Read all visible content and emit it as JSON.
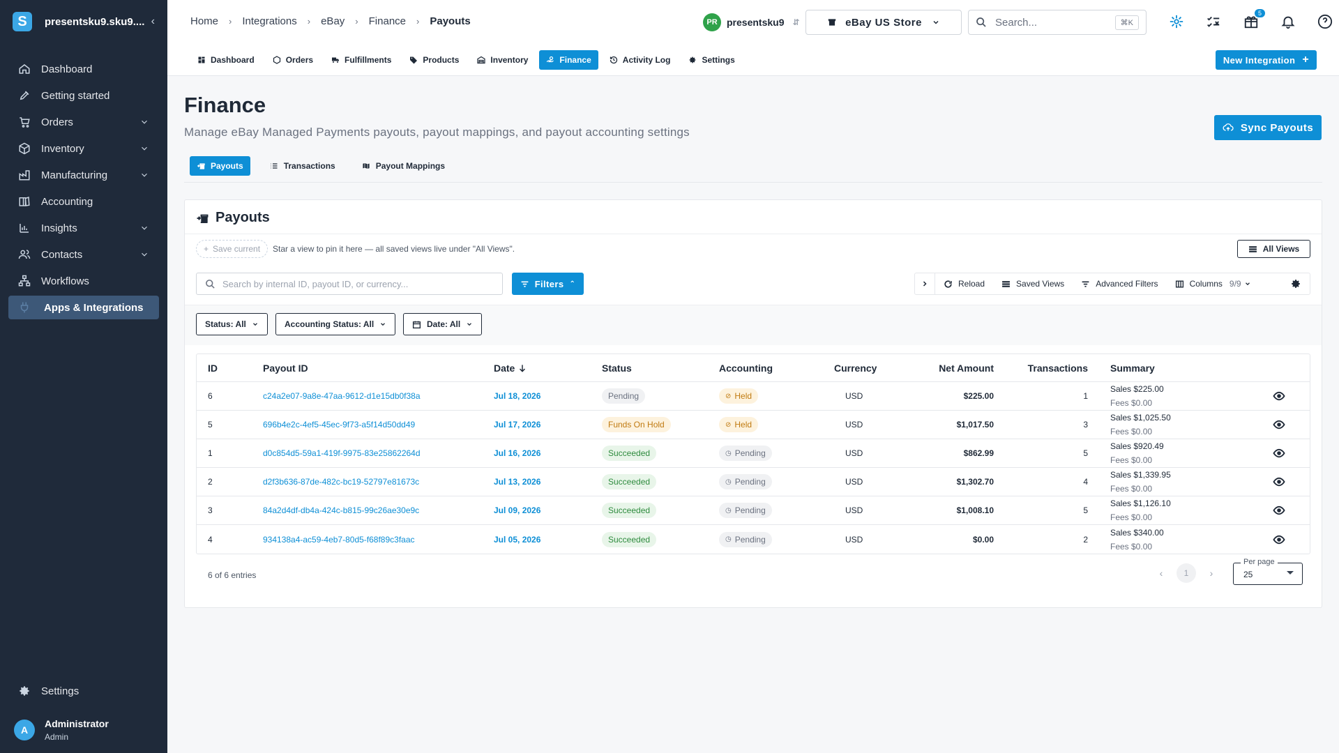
{
  "sidebar": {
    "brand_logo": "S",
    "brand_name": "presentsku9.sku9....",
    "items": [
      {
        "label": "Dashboard"
      },
      {
        "label": "Getting started"
      },
      {
        "label": "Orders"
      },
      {
        "label": "Inventory"
      },
      {
        "label": "Manufacturing"
      },
      {
        "label": "Accounting"
      },
      {
        "label": "Insights"
      },
      {
        "label": "Contacts"
      },
      {
        "label": "Workflows"
      },
      {
        "label": "Apps & Integrations"
      }
    ],
    "settings_label": "Settings",
    "user": {
      "initial": "A",
      "name": "Administrator",
      "role": "Admin"
    }
  },
  "breadcrumbs": [
    "Home",
    "Integrations",
    "eBay",
    "Finance",
    "Payouts"
  ],
  "account": {
    "initials": "PR",
    "name": "presentsku9"
  },
  "store_label": "eBay US Store",
  "global_search": {
    "placeholder": "Search...",
    "shortcut": "⌘K"
  },
  "notifications_count": "5",
  "subnav": {
    "items": [
      {
        "label": "Dashboard"
      },
      {
        "label": "Orders"
      },
      {
        "label": "Fulfillments"
      },
      {
        "label": "Products"
      },
      {
        "label": "Inventory"
      },
      {
        "label": "Finance"
      },
      {
        "label": "Activity Log"
      },
      {
        "label": "Settings"
      }
    ],
    "new_integration": "New Integration"
  },
  "page": {
    "title": "Finance",
    "subtitle": "Manage eBay Managed Payments payouts, payout mappings, and payout accounting settings",
    "sync_label": "Sync Payouts"
  },
  "tabs": [
    {
      "label": "Payouts"
    },
    {
      "label": "Transactions"
    },
    {
      "label": "Payout Mappings"
    }
  ],
  "card": {
    "title": "Payouts",
    "save_current": "Save current",
    "save_hint": "Star a view to pin it here — all saved views live under \"All Views\".",
    "all_views": "All Views",
    "search_placeholder": "Search by internal ID, payout ID, or currency...",
    "filters_label": "Filters",
    "toolbar": {
      "reload": "Reload",
      "saved_views": "Saved Views",
      "advanced_filters": "Advanced Filters",
      "columns": "Columns",
      "columns_count": "9/9"
    },
    "chips": {
      "status": "Status: All",
      "accounting": "Accounting Status: All",
      "date": "Date: All"
    }
  },
  "table": {
    "headers": {
      "id": "ID",
      "payout_id": "Payout ID",
      "date": "Date",
      "status": "Status",
      "accounting": "Accounting",
      "currency": "Currency",
      "net": "Net Amount",
      "transactions": "Transactions",
      "summary": "Summary"
    },
    "rows": [
      {
        "id": "6",
        "payout_id": "c24a2e07-9a8e-47aa-9612-d1e15db0f38a",
        "date": "Jul 18, 2026",
        "status": "Pending",
        "status_kind": "pending",
        "accounting": "Held",
        "accounting_kind": "held",
        "currency": "USD",
        "net": "$225.00",
        "transactions": "1",
        "sales": "Sales $225.00",
        "fees": "Fees $0.00"
      },
      {
        "id": "5",
        "payout_id": "696b4e2c-4ef5-45ec-9f73-a5f14d50dd49",
        "date": "Jul 17, 2026",
        "status": "Funds On Hold",
        "status_kind": "hold",
        "accounting": "Held",
        "accounting_kind": "held",
        "currency": "USD",
        "net": "$1,017.50",
        "transactions": "3",
        "sales": "Sales $1,025.50",
        "fees": "Fees $0.00"
      },
      {
        "id": "1",
        "payout_id": "d0c854d5-59a1-419f-9975-83e25862264d",
        "date": "Jul 16, 2026",
        "status": "Succeeded",
        "status_kind": "succ",
        "accounting": "Pending",
        "accounting_kind": "pending",
        "currency": "USD",
        "net": "$862.99",
        "transactions": "5",
        "sales": "Sales $920.49",
        "fees": "Fees $0.00"
      },
      {
        "id": "2",
        "payout_id": "d2f3b636-87de-482c-bc19-52797e81673c",
        "date": "Jul 13, 2026",
        "status": "Succeeded",
        "status_kind": "succ",
        "accounting": "Pending",
        "accounting_kind": "pending",
        "currency": "USD",
        "net": "$1,302.70",
        "transactions": "4",
        "sales": "Sales $1,339.95",
        "fees": "Fees $0.00"
      },
      {
        "id": "3",
        "payout_id": "84a2d4df-db4a-424c-b815-99c26ae30e9c",
        "date": "Jul 09, 2026",
        "status": "Succeeded",
        "status_kind": "succ",
        "accounting": "Pending",
        "accounting_kind": "pending",
        "currency": "USD",
        "net": "$1,008.10",
        "transactions": "5",
        "sales": "Sales $1,126.10",
        "fees": "Fees $0.00"
      },
      {
        "id": "4",
        "payout_id": "934138a4-ac59-4eb7-80d5-f68f89c3faac",
        "date": "Jul 05, 2026",
        "status": "Succeeded",
        "status_kind": "succ",
        "accounting": "Pending",
        "accounting_kind": "pending",
        "currency": "USD",
        "net": "$0.00",
        "transactions": "2",
        "sales": "Sales $340.00",
        "fees": "Fees $0.00"
      }
    ]
  },
  "footer": {
    "entries": "6 of 6 entries",
    "page": "1",
    "per_page_label": "Per page",
    "per_page": "25"
  },
  "colors": {
    "accent": "#0e8fd6",
    "sidebar": "#1f2a3a",
    "success": "#2e8b3e",
    "warning": "#c07a10"
  }
}
